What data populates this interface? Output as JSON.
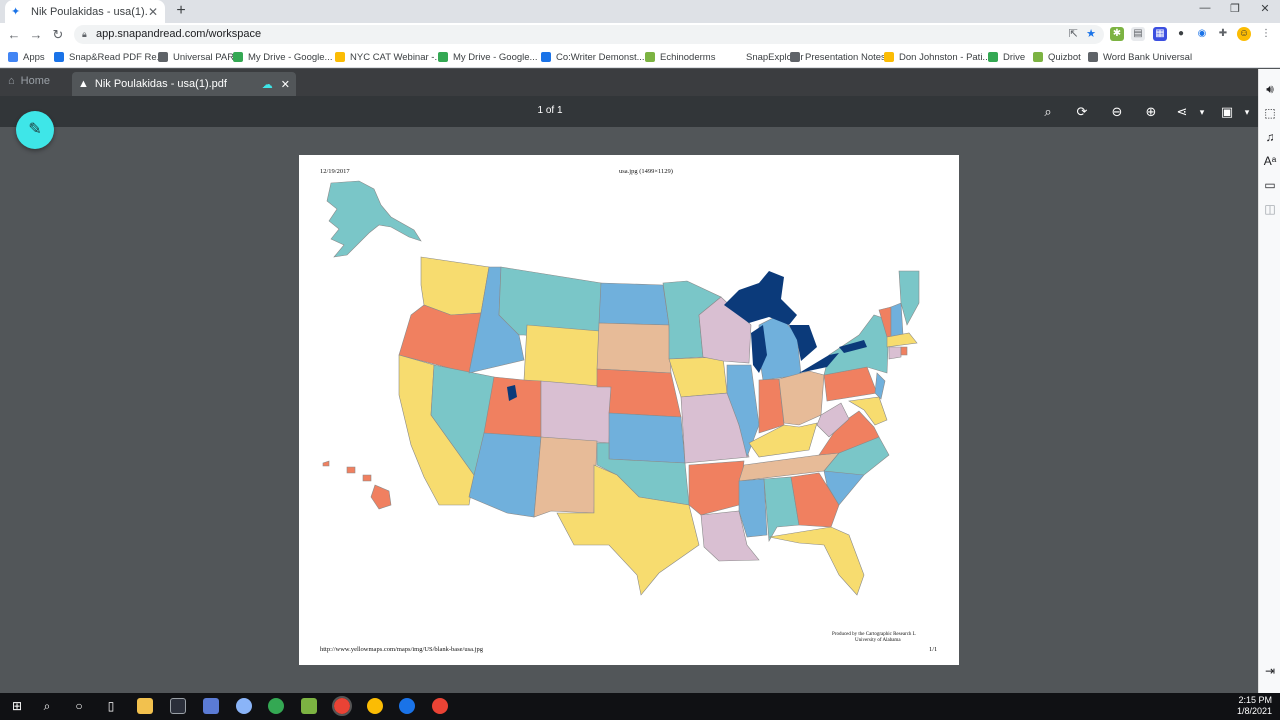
{
  "browser": {
    "tab_title": "Nik Poulakidas - usa(1).pdf",
    "url": "app.snapandread.com/workspace",
    "bookmarks": [
      {
        "label": "Apps",
        "color": "#4285f4"
      },
      {
        "label": "Snap&Read PDF Re...",
        "color": "#1a73e8"
      },
      {
        "label": "Universal PAR",
        "color": "#5f6368"
      },
      {
        "label": "My Drive - Google...",
        "color": "#34a853"
      },
      {
        "label": "NYC CAT Webinar -...",
        "color": "#fbbc04"
      },
      {
        "label": "My Drive - Google...",
        "color": "#34a853"
      },
      {
        "label": "Co:Writer Demonst...",
        "color": "#1a73e8"
      },
      {
        "label": "Echinoderms",
        "color": "#7cb342"
      },
      {
        "label": "SnapExplorer",
        "color": "#ffffff"
      },
      {
        "label": "Presentation Notes",
        "color": "#5f6368"
      },
      {
        "label": "Don Johnston - Pati...",
        "color": "#fbbc04"
      },
      {
        "label": "Drive",
        "color": "#34a853"
      },
      {
        "label": "Quizbot",
        "color": "#7cb342"
      },
      {
        "label": "Word Bank Universal",
        "color": "#5f6368"
      }
    ]
  },
  "app": {
    "home_tab": "Home",
    "doc_tab": "Nik Poulakidas - usa(1).pdf",
    "page_count": "1 of 1",
    "accent": "#3ee6e8"
  },
  "pdf": {
    "date": "12/19/2017",
    "header": "usa.jpg (1499×1129)",
    "footer_url": "http://www.yellowmaps.com/maps/img/US/blank-base/usa.jpg",
    "credit_line1": "Produced by the Cartographic Research L",
    "credit_line2": "University of Alabama",
    "page_num": "1/1"
  },
  "taskbar": {
    "time": "2:15 PM",
    "date": "1/8/2021"
  }
}
